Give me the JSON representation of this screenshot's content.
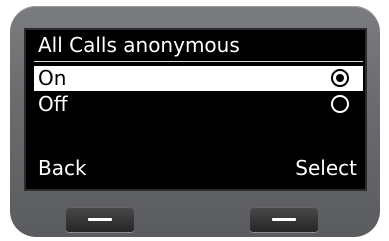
{
  "screen": {
    "title": "All Calls anonymous",
    "options": [
      {
        "label": "On",
        "selected": true
      },
      {
        "label": "Off",
        "selected": false
      }
    ]
  },
  "softkeys": {
    "left": "Back",
    "right": "Select"
  },
  "colors": {
    "screen_bg": "#000000",
    "highlight": "#ffffff",
    "device_body": "#6a6c6f"
  }
}
